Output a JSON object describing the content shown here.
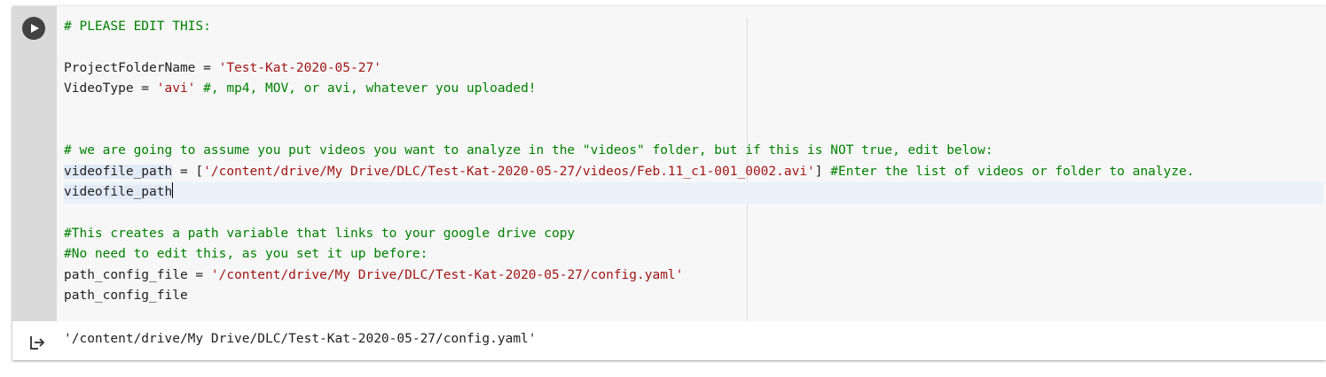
{
  "cell": {
    "run_icon": "play-icon",
    "code_lines": [
      {
        "segments": [
          {
            "t": "# PLEASE EDIT THIS:",
            "c": "cmt"
          }
        ]
      },
      {
        "segments": []
      },
      {
        "segments": [
          {
            "t": "ProjectFolderName = ",
            "c": ""
          },
          {
            "t": "'Test-Kat-2020-05-27'",
            "c": "str"
          }
        ]
      },
      {
        "segments": [
          {
            "t": "VideoType = ",
            "c": ""
          },
          {
            "t": "'avi'",
            "c": "str"
          },
          {
            "t": " #, mp4, MOV, or avi, whatever you uploaded!",
            "c": "cmt"
          }
        ]
      },
      {
        "segments": []
      },
      {
        "segments": []
      },
      {
        "segments": [
          {
            "t": "# we are going to assume you put videos you want to analyze in the \"videos\" folder, but if this is NOT true, edit below:",
            "c": "cmt"
          }
        ]
      },
      {
        "segments": [
          {
            "t": "videofile_path",
            "c": "sel"
          },
          {
            "t": " = [",
            "c": ""
          },
          {
            "t": "'/content/drive/My Drive/DLC/Test-Kat-2020-05-27/videos/Feb.11_c1-001_0002.avi'",
            "c": "str"
          },
          {
            "t": "] ",
            "c": ""
          },
          {
            "t": "#Enter the list of videos or folder to analyze.",
            "c": "cmt"
          }
        ]
      },
      {
        "segments": [
          {
            "t": "videofile_path",
            "c": "sel"
          }
        ],
        "caret": true,
        "active": true
      },
      {
        "segments": []
      },
      {
        "segments": [
          {
            "t": "#This creates a path variable that links to your google drive copy",
            "c": "cmt"
          }
        ]
      },
      {
        "segments": [
          {
            "t": "#No need to edit this, as you set it up before:",
            "c": "cmt"
          }
        ]
      },
      {
        "segments": [
          {
            "t": "path_config_file = ",
            "c": ""
          },
          {
            "t": "'/content/drive/My Drive/DLC/Test-Kat-2020-05-27/config.yaml'",
            "c": "str"
          }
        ]
      },
      {
        "segments": [
          {
            "t": "path_config_file",
            "c": ""
          }
        ]
      }
    ]
  },
  "output": {
    "icon": "output-arrow-icon",
    "text": "'/content/drive/My Drive/DLC/Test-Kat-2020-05-27/config.yaml'"
  },
  "colors": {
    "comment": "#008000",
    "string": "#a31515",
    "editor_bg": "#f7f7f7",
    "gutter_bg": "#dadada",
    "run_button": "#424242"
  }
}
